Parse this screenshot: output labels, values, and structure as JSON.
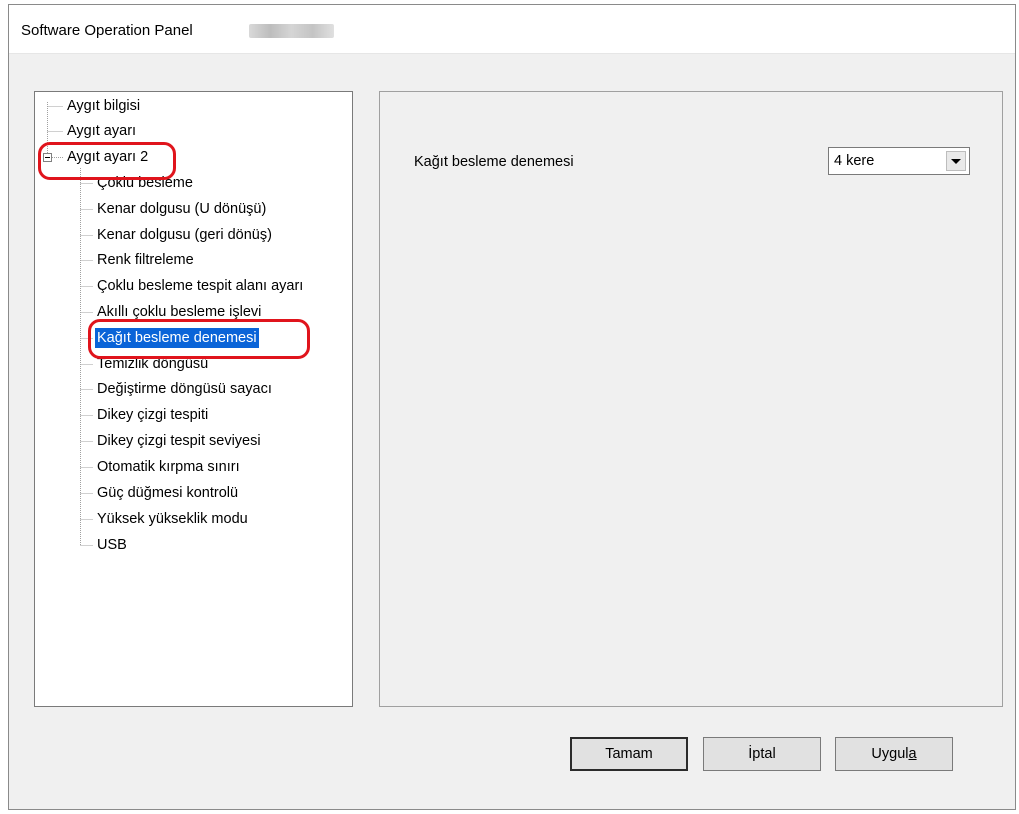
{
  "window": {
    "title": "Software Operation Panel"
  },
  "tree": {
    "items": [
      {
        "label": "Aygıt bilgisi"
      },
      {
        "label": "Aygıt ayarı"
      },
      {
        "label": "Aygıt ayarı 2",
        "expanded": true
      },
      {
        "label": "Çoklu besleme"
      },
      {
        "label": "Kenar dolgusu (U dönüşü)"
      },
      {
        "label": "Kenar dolgusu (geri dönüş)"
      },
      {
        "label": "Renk filtreleme"
      },
      {
        "label": "Çoklu besleme tespit alanı ayarı"
      },
      {
        "label": "Akıllı çoklu besleme işlevi"
      },
      {
        "label": "Kağıt besleme denemesi",
        "selected": true
      },
      {
        "label": "Temizlik döngüsü"
      },
      {
        "label": "Değiştirme döngüsü sayacı"
      },
      {
        "label": "Dikey çizgi tespiti"
      },
      {
        "label": "Dikey çizgi tespit seviyesi"
      },
      {
        "label": "Otomatik kırpma sınırı"
      },
      {
        "label": "Güç düğmesi kontrolü"
      },
      {
        "label": "Yüksek yükseklik modu"
      },
      {
        "label": "USB"
      }
    ]
  },
  "content": {
    "setting_label": "Kağıt besleme denemesi",
    "setting_value": "4 kere"
  },
  "buttons": {
    "ok": "Tamam",
    "cancel": "İptal",
    "apply_prefix": "Uygul",
    "apply_accel": "a"
  },
  "colors": {
    "selection": "#0a64d8",
    "highlight": "#e0141c"
  }
}
